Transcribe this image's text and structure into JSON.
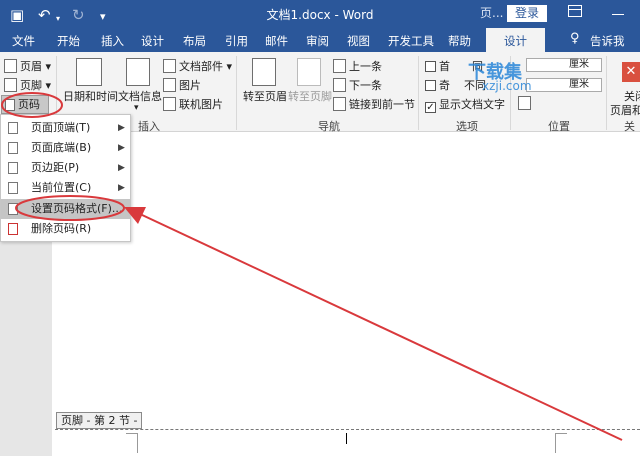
{
  "titlebar": {
    "save_icon": "save-icon",
    "undo_icon": "undo-icon",
    "redo_icon": "redo-icon",
    "title": "文档1.docx - Word",
    "context_tab": "页...",
    "login": "登录"
  },
  "tabs": [
    {
      "label": "文件"
    },
    {
      "label": "开始"
    },
    {
      "label": "插入"
    },
    {
      "label": "设计"
    },
    {
      "label": "布局"
    },
    {
      "label": "引用"
    },
    {
      "label": "邮件"
    },
    {
      "label": "审阅"
    },
    {
      "label": "视图"
    },
    {
      "label": "开发工具"
    },
    {
      "label": "帮助"
    },
    {
      "label": "设计"
    },
    {
      "label": "告诉我"
    }
  ],
  "ribbon": {
    "header": "页眉",
    "footer": "页脚",
    "page_number": "页码",
    "date_time": "日期和时间",
    "doc_info": "文档信息",
    "doc_parts": "文档部件",
    "picture": "图片",
    "online_picture": "联机图片",
    "insert_group": "插入",
    "goto_header": "转至页眉",
    "goto_footer": "转至页脚",
    "prev": "上一条",
    "next": "下一条",
    "link_prev": "链接到前一节",
    "nav_group": "导航",
    "opt1": "首",
    "opt1_tail": "同",
    "opt2": "奇",
    "opt2_tail": "不同",
    "show_text": "显示文档文字",
    "options_group": "选项",
    "unit1": "厘米",
    "unit2": "厘米",
    "position_group": "位置",
    "close_a": "关闭",
    "close_b": "页眉和",
    "close_group": "关闭",
    "watermark_1": "下载集",
    "watermark_2": "xzji.com"
  },
  "dropdown": {
    "items": [
      {
        "label": "页面顶端(T)"
      },
      {
        "label": "页面底端(B)"
      },
      {
        "label": "页边距(P)"
      },
      {
        "label": "当前位置(C)"
      },
      {
        "label": "设置页码格式(F)..."
      },
      {
        "label": "删除页码(R)"
      }
    ]
  },
  "document": {
    "footer_tag": "页脚 - 第 2 节 -"
  },
  "colors": {
    "titlebar": "#2b579a",
    "annotation": "#d9393c"
  }
}
